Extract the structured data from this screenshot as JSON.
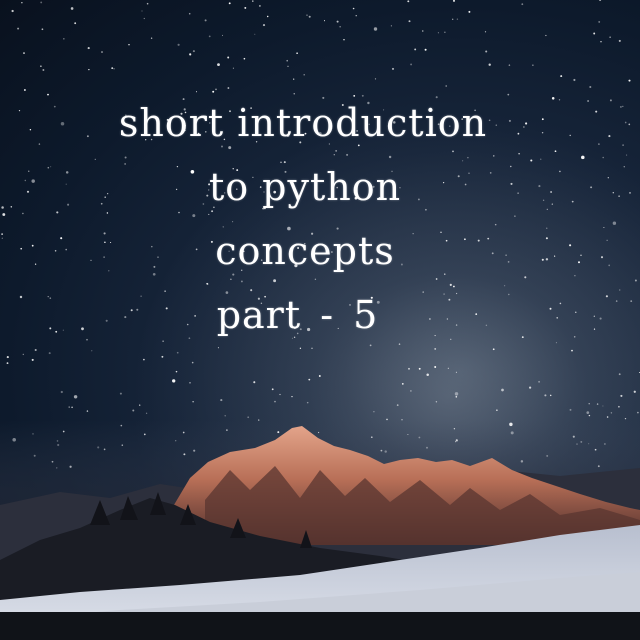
{
  "text": {
    "line1": "short introduction",
    "line2": "to python",
    "line3": "concepts",
    "line4": "part - 5"
  },
  "colors": {
    "sky_dark": "#09111e",
    "sky_mid": "#17253a",
    "glow": "#c8866a",
    "snow": "#dcdfe8"
  }
}
